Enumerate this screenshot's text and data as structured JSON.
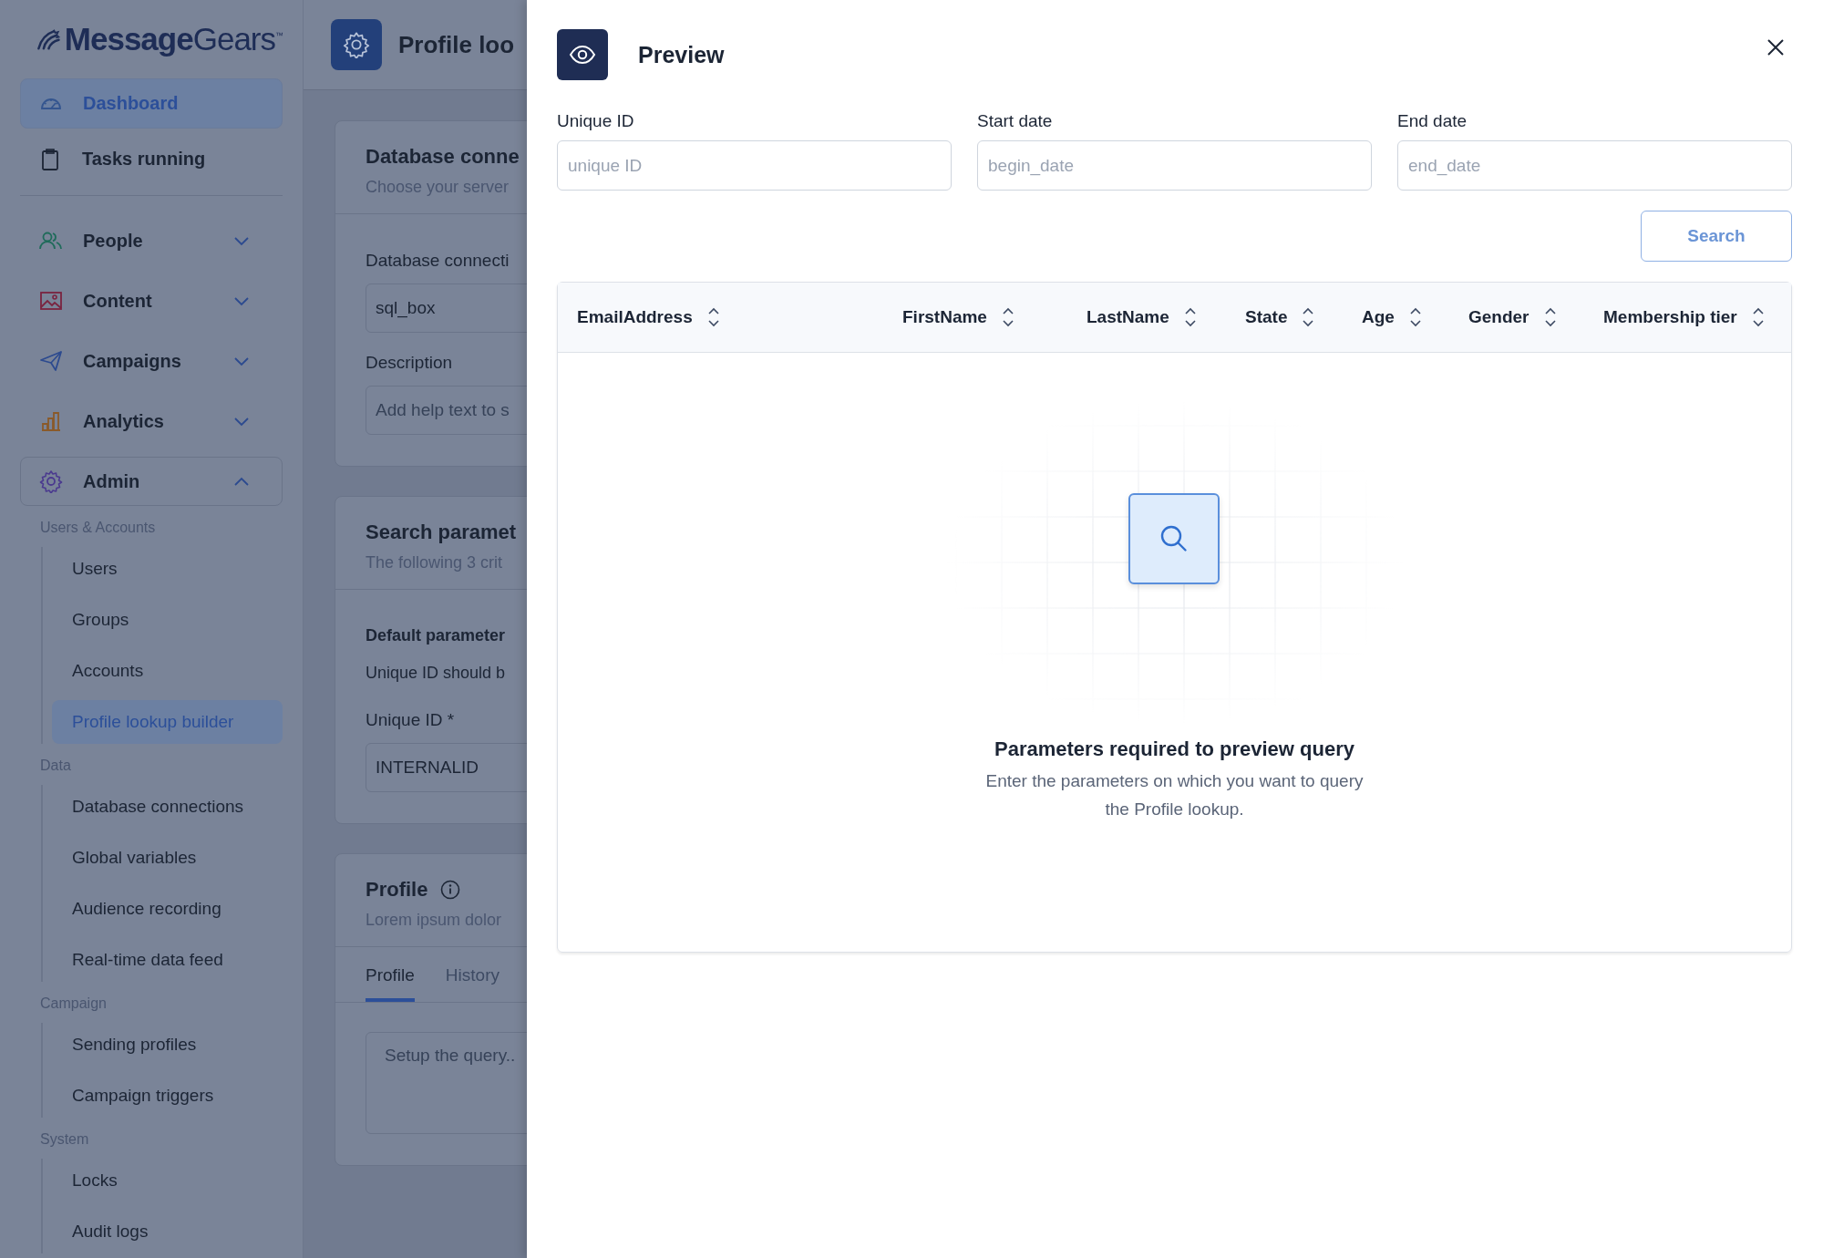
{
  "sidebar": {
    "logo": "**Message**Gears$^{™}$",
    "nav": [
      {
        "label": "Dashboard",
        "selected": true
      },
      {
        "label": "Tasks running",
        "selected": false
      }
    ],
    "groups": [
      {
        "label": "People",
        "expanded": false
      },
      {
        "label": "Content",
        "expanded": false
      },
      {
        "label": "Campaigns",
        "expanded": false
      },
      {
        "label": "Analytics",
        "expanded": false
      },
      {
        "label": "Admin",
        "expanded": true
      }
    ],
    "sections": [
      {
        "heading": "Users & Accounts",
        "items": [
          {
            "label": "Users",
            "selected": false
          },
          {
            "label": "Groups",
            "selected": false
          },
          {
            "label": "Accounts",
            "selected": false
          },
          {
            "label": "Profile lookup builder",
            "selected": true
          }
        ]
      },
      {
        "heading": "Data",
        "items": [
          {
            "label": "Database connections",
            "selected": false
          },
          {
            "label": "Global variables",
            "selected": false
          },
          {
            "label": "Audience recording",
            "selected": false
          },
          {
            "label": "Real-time data feed",
            "selected": false
          }
        ]
      },
      {
        "heading": "Campaign",
        "items": [
          {
            "label": "Sending profiles",
            "selected": false
          },
          {
            "label": "Campaign triggers",
            "selected": false
          }
        ]
      },
      {
        "heading": "System",
        "items": [
          {
            "label": "Locks",
            "selected": false
          },
          {
            "label": "Audit logs",
            "selected": false
          }
        ]
      }
    ]
  },
  "page": {
    "title": "Profile loo",
    "cards": [
      {
        "title": "Database conne",
        "subtitle": "Choose your server",
        "blocks": [
          {
            "kind": "field",
            "label": "Database connecti",
            "value": "sql_box"
          },
          {
            "kind": "field",
            "label": "Description",
            "placeholder": "Add help text to s"
          }
        ]
      },
      {
        "title": "Search paramet",
        "subtitle": "The following 3 crit",
        "blocks": [
          {
            "kind": "note",
            "heading": "Default parameter",
            "text": "Unique ID should b"
          },
          {
            "kind": "field",
            "label": "Unique ID *",
            "value": "INTERNALID"
          }
        ]
      },
      {
        "title": "Profile",
        "info": true,
        "subtitle": "Lorem ipsum dolor",
        "blocks": [
          {
            "kind": "tabs",
            "tabs": [
              {
                "label": "Profile",
                "selected": true
              },
              {
                "label": "History",
                "selected": false
              }
            ]
          },
          {
            "kind": "textarea",
            "placeholder": "Setup the query.."
          }
        ]
      }
    ]
  },
  "preview": {
    "title": "Preview",
    "fields": [
      {
        "label": "Unique ID",
        "placeholder": "unique ID"
      },
      {
        "label": "Start date",
        "placeholder": "begin_date"
      },
      {
        "label": "End date",
        "placeholder": "end_date"
      }
    ],
    "search_button": "Search",
    "table": {
      "columns": [
        "EmailAddress",
        "FirstName",
        "LastName",
        "State",
        "Age",
        "Gender",
        "Membership tier"
      ],
      "empty_state": {
        "title": "Parameters required to preview query",
        "text": "Enter the parameters on which you want to query the Profile lookup."
      }
    }
  }
}
